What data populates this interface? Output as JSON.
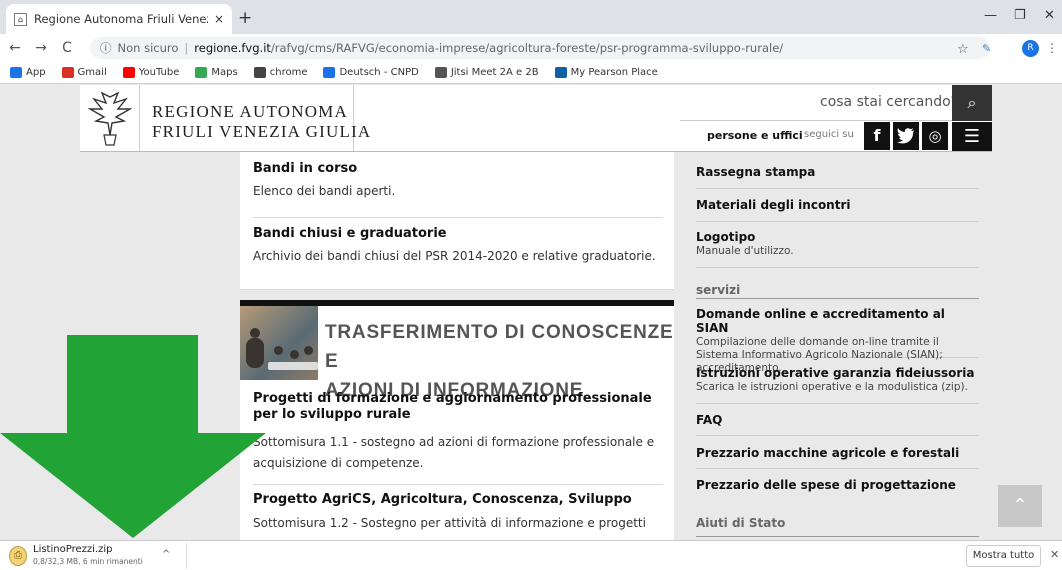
{
  "browser": {
    "tab_title": "Regione Autonoma Friuli Venezia",
    "tab_close": "×",
    "new_tab": "+",
    "minimize": "—",
    "restore": "❐",
    "close": "✕",
    "back": "←",
    "forward": "→",
    "reload": "C",
    "info_icon": "ⓘ",
    "not_secure": "Non sicuro",
    "url_domain": "regione.fvg.it",
    "url_path": "/rafvg/cms/RAFVG/economia-imprese/agricoltura-foreste/psr-programma-sviluppo-rurale/",
    "avatar_letter": "R",
    "bookmarks": [
      {
        "label": "App",
        "icon": "apps-icon",
        "color": "#1a73e8"
      },
      {
        "label": "Gmail",
        "icon": "gmail-icon",
        "color": "#d93025"
      },
      {
        "label": "YouTube",
        "icon": "youtube-icon",
        "color": "#ff0000"
      },
      {
        "label": "Maps",
        "icon": "maps-icon",
        "color": "#34a853"
      },
      {
        "label": "chrome",
        "icon": "chrome-icon",
        "color": "#444444"
      },
      {
        "label": "Deutsch - CNPD",
        "icon": "calendar-icon",
        "color": "#1a73e8"
      },
      {
        "label": "Jitsi Meet 2A e 2B",
        "icon": "pen-icon",
        "color": "#555555"
      },
      {
        "label": "My Pearson Place",
        "icon": "pearson-icon",
        "color": "#0d5fa6"
      }
    ]
  },
  "header": {
    "brand_line1": "REGIONE AUTONOMA",
    "brand_line2": "FRIULI VENEZIA GIULIA",
    "search_placeholder": "cosa stai cercando?",
    "persone": "persone e uffici",
    "seguici": "seguici su",
    "social": [
      "f",
      "t",
      "◎"
    ],
    "menu": "☰"
  },
  "main": {
    "card1": [
      {
        "title": "Bandi in corso",
        "desc": "Elenco dei bandi aperti."
      },
      {
        "title": "Bandi chiusi e graduatorie",
        "desc": "Archivio dei bandi chiusi del PSR 2014-2020 e relative graduatorie."
      }
    ],
    "card2": {
      "title_line1": "TRASFERIMENTO DI CONOSCENZE E",
      "title_line2": "AZIONI DI INFORMAZIONE",
      "items": [
        {
          "title": "Progetti di formazione e aggiornamento professionale per lo sviluppo rurale",
          "desc": "Sottomisura 1.1 - sostegno ad azioni di formazione professionale e acquisizione di competenze."
        },
        {
          "title": "Progetto AgriCS, Agricoltura, Conoscenza, Sviluppo",
          "desc": "Sottomisura 1.2 - Sostegno per attività di informazione e progetti"
        }
      ]
    }
  },
  "sidebar": {
    "items": [
      {
        "title": "Rassegna stampa",
        "desc": ""
      },
      {
        "title": "Materiali degli incontri",
        "desc": ""
      },
      {
        "title": "Logotipo",
        "desc": "Manuale d'utilizzo."
      },
      {
        "section": "servizi"
      },
      {
        "title": "Domande online e accreditamento al SIAN",
        "desc": "Compilazione delle domande on-line tramite il Sistema Informativo Agricolo Nazionale (SIAN); accreditamento."
      },
      {
        "title": "Istruzioni operative garanzia fideiussoria",
        "desc": "Scarica le istruzioni operative e la modulistica (zip)."
      },
      {
        "title": "FAQ",
        "desc": ""
      },
      {
        "title": "Prezzario macchine agricole e forestali",
        "desc": ""
      },
      {
        "title": "Prezzario delle spese di progettazione",
        "desc": ""
      },
      {
        "section": "Aiuti di Stato"
      }
    ]
  },
  "scroll_top": "⌃",
  "download": {
    "filename": "ListinoPrezzi.zip",
    "meta": "0,8/32,3 MB, 6 min rimanenti",
    "show_all": "Mostra tutto",
    "close": "✕",
    "chevron": "^"
  },
  "colors": {
    "arrow": "#21a336",
    "header_dark": "#111111"
  }
}
